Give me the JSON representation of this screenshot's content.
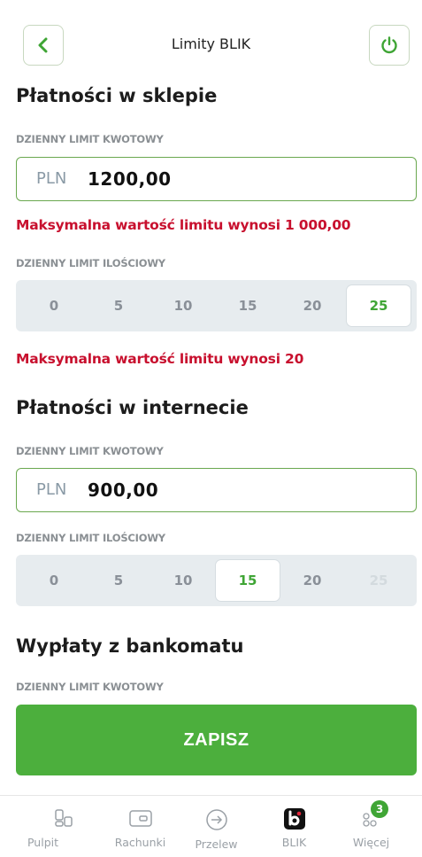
{
  "header": {
    "title": "Limity BLIK"
  },
  "shop": {
    "title": "Płatności w sklepie",
    "amount_label": "DZIENNY LIMIT KWOTOWY",
    "currency": "PLN",
    "amount": "1200,00",
    "amount_error": "Maksymalna wartość limitu wynosi 1 000,00",
    "count_label": "DZIENNY LIMIT ILOŚCIOWY",
    "options": [
      "0",
      "5",
      "10",
      "15",
      "20",
      "25"
    ],
    "selected": "25",
    "count_error": "Maksymalna wartość limitu wynosi 20"
  },
  "internet": {
    "title": "Płatności w internecie",
    "amount_label": "DZIENNY LIMIT KWOTOWY",
    "currency": "PLN",
    "amount": "900,00",
    "count_label": "DZIENNY LIMIT ILOŚCIOWY",
    "options": [
      "0",
      "5",
      "10",
      "15",
      "20",
      "25"
    ],
    "selected": "15",
    "disabled": [
      "25"
    ]
  },
  "atm": {
    "title": "Wypłaty z bankomatu",
    "amount_label": "DZIENNY LIMIT KWOTOWY"
  },
  "save_label": "ZAPISZ",
  "nav": {
    "items": [
      {
        "label": "Pulpit",
        "icon": "dashboard-icon"
      },
      {
        "label": "Rachunki",
        "icon": "wallet-icon"
      },
      {
        "label": "Przelew",
        "icon": "transfer-icon"
      },
      {
        "label": "BLIK",
        "icon": "blik-icon"
      },
      {
        "label": "Więcej",
        "icon": "more-icon"
      }
    ],
    "more_badge": "3"
  },
  "colors": {
    "accent": "#4caf3d",
    "error": "#c8102e",
    "selected_text": "#3fa535"
  }
}
